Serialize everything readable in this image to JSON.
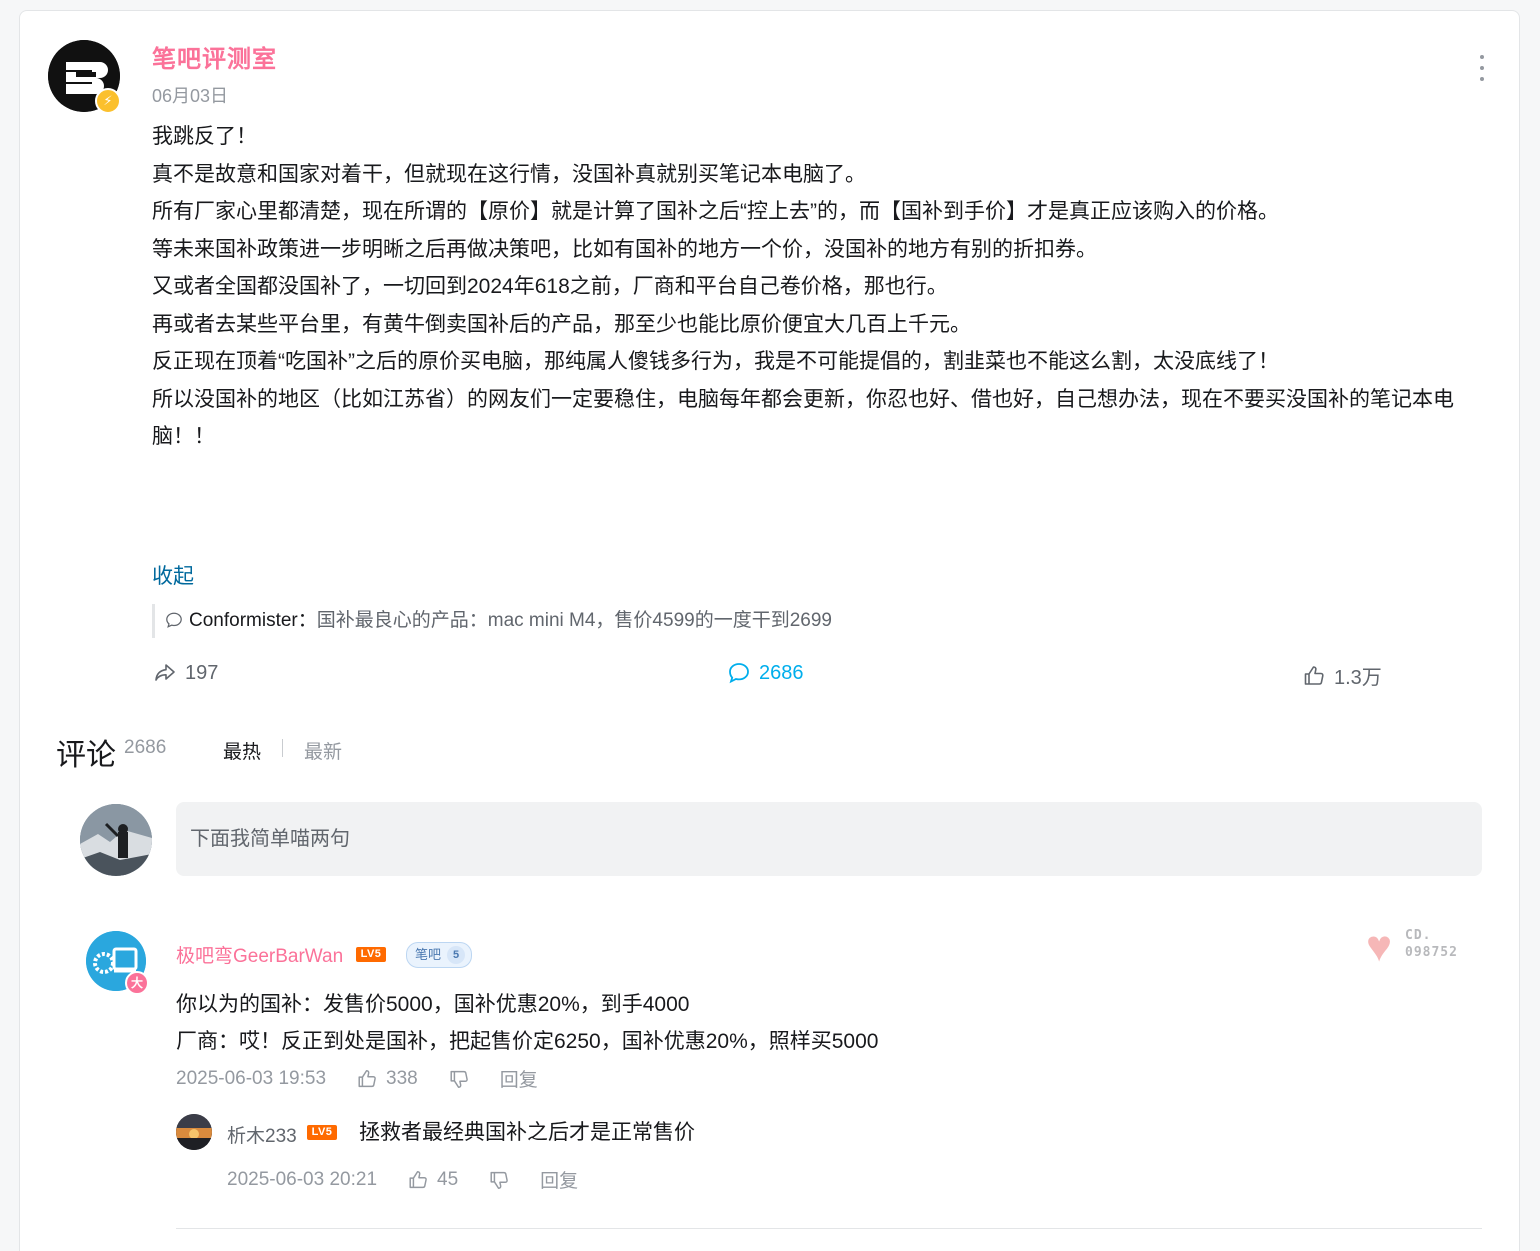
{
  "post": {
    "author": "笔吧评测室",
    "date": "06月03日",
    "paragraphs": [
      "我跳反了！",
      "",
      "真不是故意和国家对着干，但就现在这行情，没国补真就别买笔记本电脑了。",
      "所有厂家心里都清楚，现在所谓的【原价】就是计算了国补之后“控上去”的，而【国补到手价】才是真正应该购入的价格。",
      "",
      "等未来国补政策进一步明晰之后再做决策吧，比如有国补的地方一个价，没国补的地方有别的折扣券。",
      "又或者全国都没国补了，一切回到2024年618之前，厂商和平台自己卷价格，那也行。",
      "再或者去某些平台里，有黄牛倒卖国补后的产品，那至少也能比原价便宜大几百上千元。",
      "",
      "反正现在顶着“吃国补”之后的原价买电脑，那纯属人傻钱多行为，我是不可能提倡的，割韭菜也不能这么割，太没底线了！",
      "所以没国补的地区（比如江苏省）的网友们一定要稳住，电脑每年都会更新，你忍也好、借也好，自己想办法，现在不要买没国补的笔记本电脑！！"
    ],
    "collapse_label": "收起",
    "quote_name": "Conformister：",
    "quote_text": "国补最良心的产品：mac mini M4，售价4599的一度干到2699",
    "share_count": "197",
    "comment_count": "2686",
    "like_count": "1.3万"
  },
  "comments_section": {
    "title": "评论",
    "count": "2686",
    "sort_hot": "最热",
    "sort_new": "最新",
    "input_placeholder": "下面我简单喵两句"
  },
  "comment": {
    "author": "极吧弯GeerBarWan",
    "level": "LV5",
    "fan_badge_label": "笔吧",
    "fan_badge_level": "5",
    "avatar_badge": "大",
    "decoration_text_1": "CD.",
    "decoration_text_2": "098752",
    "lines": [
      "你以为的国补：发售价5000，国补优惠20%，到手4000",
      "厂商：哎！反正到处是国补，把起售价定6250，国补优惠20%，照样买5000"
    ],
    "time": "2025-06-03 19:53",
    "likes": "338",
    "reply_label": "回复"
  },
  "reply": {
    "author": "析木233",
    "level": "LV5",
    "text": "拯救者最经典国补之后才是正常售价",
    "time": "2025-06-03 20:21",
    "likes": "45",
    "reply_label": "回复"
  },
  "colors": {
    "author_pink": "#fb7299",
    "link_blue": "#00699d",
    "comment_blue": "#00aeec",
    "muted": "#9499a0"
  }
}
